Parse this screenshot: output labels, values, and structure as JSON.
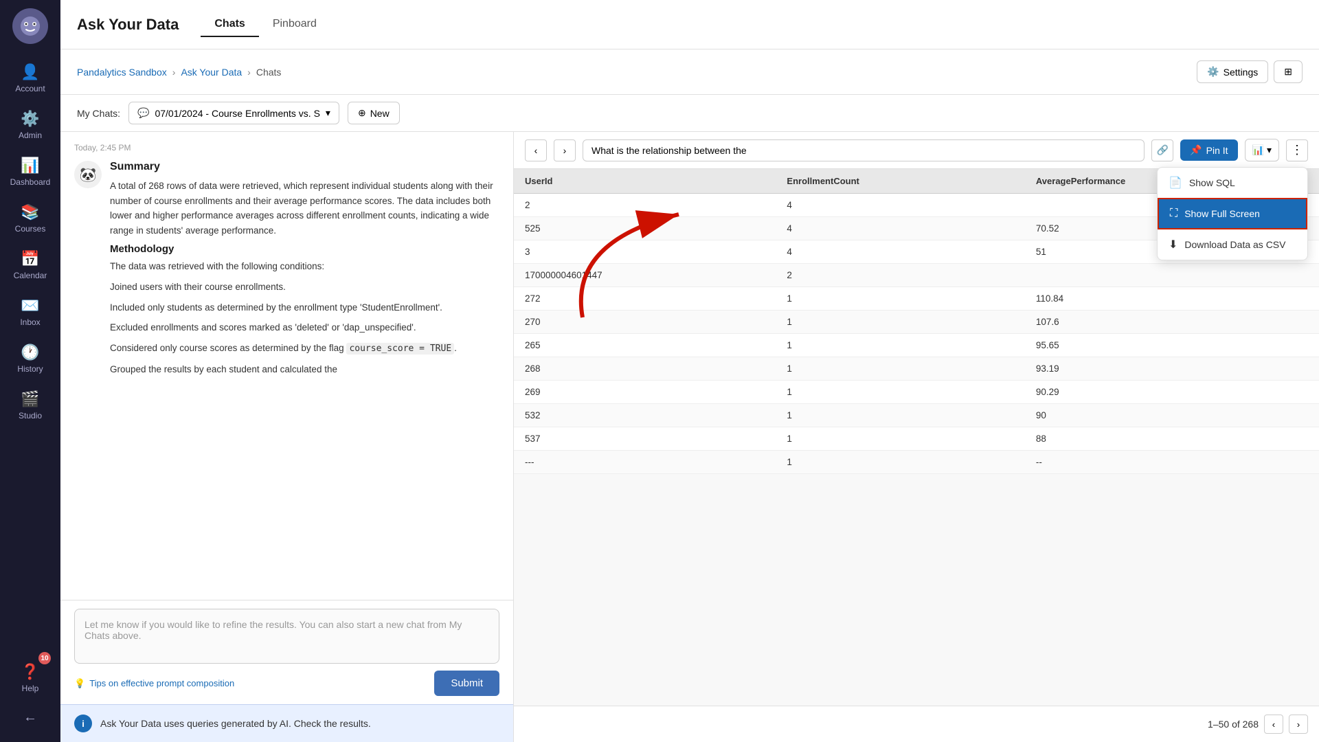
{
  "app": {
    "title": "Ask Your Data",
    "logo_emoji": "🎯"
  },
  "sidebar": {
    "items": [
      {
        "id": "account",
        "label": "Account",
        "icon": "👤"
      },
      {
        "id": "admin",
        "label": "Admin",
        "icon": "⚙️"
      },
      {
        "id": "dashboard",
        "label": "Dashboard",
        "icon": "📊"
      },
      {
        "id": "courses",
        "label": "Courses",
        "icon": "📚"
      },
      {
        "id": "calendar",
        "label": "Calendar",
        "icon": "📅"
      },
      {
        "id": "inbox",
        "label": "Inbox",
        "icon": "✉️"
      },
      {
        "id": "history",
        "label": "History",
        "icon": "🕐"
      },
      {
        "id": "studio",
        "label": "Studio",
        "icon": "🎬"
      },
      {
        "id": "help",
        "label": "Help",
        "icon": "❓",
        "badge": "10"
      }
    ],
    "collapse_icon": "←"
  },
  "header": {
    "app_title": "Ask Your Data",
    "tabs": [
      {
        "id": "chats",
        "label": "Chats",
        "active": true
      },
      {
        "id": "pinboard",
        "label": "Pinboard",
        "active": false
      }
    ]
  },
  "breadcrumb": {
    "items": [
      {
        "label": "Pandalytics Sandbox",
        "link": true
      },
      {
        "label": "Ask Your Data",
        "link": true
      },
      {
        "label": "Chats",
        "link": false
      }
    ],
    "separator": "›"
  },
  "settings_btn": "Settings",
  "chat_toolbar": {
    "label": "My Chats:",
    "selected_chat": "07/01/2024 - Course Enrollments vs. S",
    "new_btn": "New"
  },
  "chat": {
    "timestamp": "Today, 2:45 PM",
    "summary_title": "Summary",
    "summary_text": "A total of 268 rows of data were retrieved, which represent individual students along with their number of course enrollments and their average performance scores. The data includes both lower and higher performance averages across different enrollment counts, indicating a wide range in students' average performance.",
    "methodology_title": "Methodology",
    "methodology_lines": [
      "The data was retrieved with the following conditions:",
      "Joined users with their course enrollments.",
      "Included only students as determined by the enrollment type 'StudentEnrollment'.",
      "Excluded enrollments and scores marked as 'deleted' or 'dap_unspecified'.",
      "Considered only course scores as determined by the flag course_score = TRUE.",
      "Grouped the results by each student and calculated the"
    ],
    "input_placeholder": "Let me know if you would like to refine the results.  You can also start a new chat from My Chats above.",
    "tips_label": "Tips on effective prompt composition",
    "submit_btn": "Submit",
    "ai_notice": "Ask Your Data uses queries generated by AI. Check the results."
  },
  "data_panel": {
    "query_text": "What is the relationship between the",
    "nav_back": "‹",
    "nav_forward": "›",
    "pin_btn": "Pin It",
    "chart_btn": "📊",
    "more_btn": "⋮",
    "table": {
      "columns": [
        "UserId",
        "EnrollmentCount",
        "AveragePerformance"
      ],
      "rows": [
        [
          "2",
          "4",
          ""
        ],
        [
          "525",
          "4",
          "70.52"
        ],
        [
          "3",
          "4",
          "51"
        ],
        [
          "170000004601447",
          "2",
          ""
        ],
        [
          "272",
          "1",
          "110.84"
        ],
        [
          "270",
          "1",
          "107.6"
        ],
        [
          "265",
          "1",
          "95.65"
        ],
        [
          "268",
          "1",
          "93.19"
        ],
        [
          "269",
          "1",
          "90.29"
        ],
        [
          "532",
          "1",
          "90"
        ],
        [
          "537",
          "1",
          "88"
        ],
        [
          "---",
          "1",
          "--"
        ]
      ]
    },
    "pagination": {
      "text": "1–50 of 268",
      "prev": "‹",
      "next": "›"
    },
    "dropdown": {
      "items": [
        {
          "id": "show-sql",
          "label": "Show SQL",
          "icon": "📄"
        },
        {
          "id": "show-full-screen",
          "label": "Show Full Screen",
          "icon": "⛶",
          "highlighted": true
        },
        {
          "id": "download-csv",
          "label": "Download Data as CSV",
          "icon": "⬇"
        }
      ]
    }
  }
}
